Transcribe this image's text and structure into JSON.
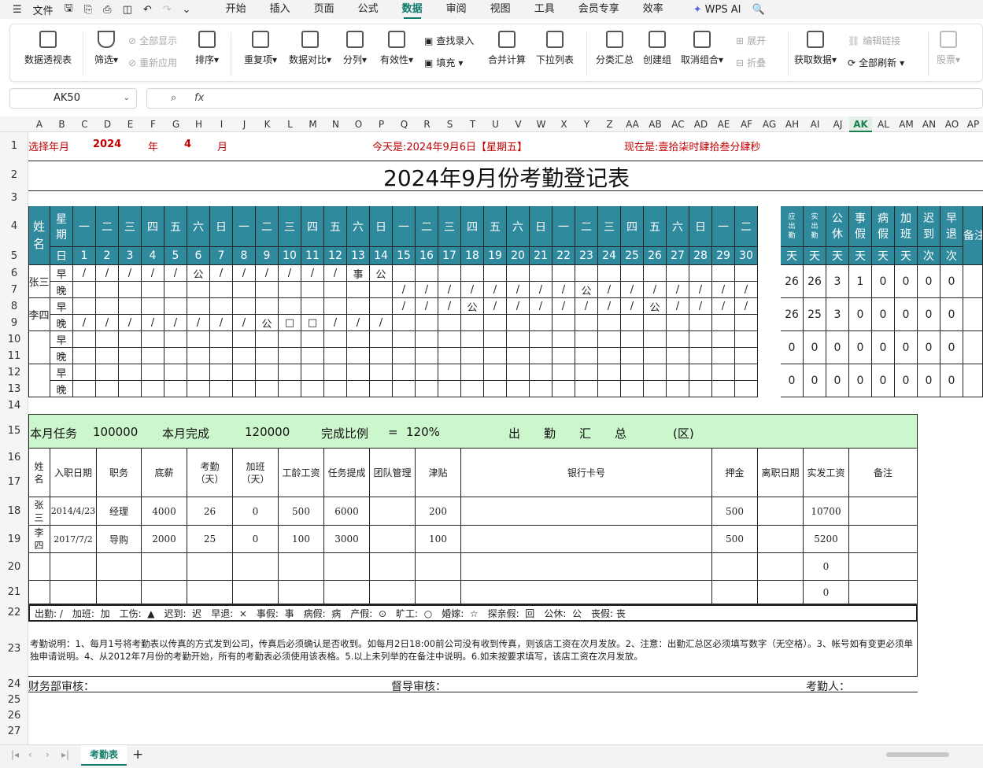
{
  "menubar": {
    "file": "文件",
    "tabs": [
      "开始",
      "插入",
      "页面",
      "公式",
      "数据",
      "审阅",
      "视图",
      "工具",
      "会员专享",
      "效率"
    ],
    "active_tab": "数据",
    "wps_ai": "WPS AI"
  },
  "ribbon": {
    "pivot": "数据透视表",
    "filter": "筛选",
    "show_all": "全部显示",
    "reapply": "重新应用",
    "sort": "排序",
    "duplicates": "重复项",
    "compare": "数据对比",
    "split": "分列",
    "validity": "有效性",
    "find_entry": "查找录入",
    "fill": "填充",
    "merge_calc": "合并计算",
    "dropdown_list": "下拉列表",
    "subtotal": "分类汇总",
    "create_group": "创建组",
    "ungroup": "取消组合",
    "expand": "展开",
    "collapse": "折叠",
    "get_data": "获取数据",
    "edit_links": "编辑链接",
    "refresh_all": "全部刷新",
    "stocks": "股票"
  },
  "formula_bar": {
    "cell_ref": "AK50",
    "fx": "fx",
    "value": ""
  },
  "columns": [
    "A",
    "B",
    "C",
    "D",
    "E",
    "F",
    "G",
    "H",
    "I",
    "J",
    "K",
    "L",
    "M",
    "N",
    "O",
    "P",
    "Q",
    "R",
    "S",
    "T",
    "U",
    "V",
    "W",
    "X",
    "Y",
    "Z",
    "AA",
    "AB",
    "AC",
    "AD",
    "AE",
    "AF",
    "AG",
    "AH",
    "AI",
    "AJ",
    "AK",
    "AL",
    "AM",
    "AN",
    "AO",
    "AP"
  ],
  "selected_column": "AK",
  "rows": [
    "1",
    "2",
    "3",
    "4",
    "5",
    "6",
    "7",
    "8",
    "9",
    "10",
    "11",
    "12",
    "13",
    "14",
    "15",
    "16",
    "17",
    "18",
    "19",
    "20",
    "21",
    "22",
    "23",
    "24",
    "25",
    "26",
    "27"
  ],
  "sheet": {
    "row1": {
      "select_label": "选择年月",
      "year": "2024",
      "year_unit": "年",
      "month": "4",
      "month_unit": "月",
      "today": "今天是:2024年9月6日【星期五】",
      "now": "现在是:壹拾柒时肆拾叁分肆秒"
    },
    "title": "2024年9月份考勤登记表",
    "header": {
      "name": "姓名",
      "week": "星期",
      "day": "日",
      "weekdays": [
        "一",
        "二",
        "三",
        "四",
        "五",
        "六",
        "日",
        "一",
        "二",
        "三",
        "四",
        "五",
        "六",
        "日",
        "一",
        "二",
        "三",
        "四",
        "五",
        "六",
        "日",
        "一",
        "二",
        "三",
        "四",
        "五",
        "六",
        "日",
        "一",
        "二"
      ],
      "days": [
        "1",
        "2",
        "3",
        "4",
        "5",
        "6",
        "7",
        "8",
        "9",
        "10",
        "11",
        "12",
        "13",
        "14",
        "15",
        "16",
        "17",
        "18",
        "19",
        "20",
        "21",
        "22",
        "23",
        "24",
        "25",
        "26",
        "27",
        "28",
        "29",
        "30"
      ],
      "summary": [
        "应出勤",
        "实出勤",
        "公休",
        "事假",
        "病假",
        "加班",
        "迟到",
        "早退"
      ],
      "summary_units": [
        "天",
        "天",
        "天",
        "天",
        "天",
        "天",
        "次",
        "次"
      ],
      "remark": "备注"
    },
    "employees": [
      {
        "name": "张三",
        "am_label": "早",
        "pm_label": "晚",
        "am": [
          "/",
          "/",
          "/",
          "/",
          "/",
          "公",
          "/",
          "/",
          "/",
          "/",
          "/",
          "/",
          "事",
          "公",
          "",
          "",
          "",
          "",
          "",
          "",
          "",
          "",
          "",
          "",
          "",
          "",
          "",
          "",
          "",
          ""
        ],
        "pm": [
          "",
          "",
          "",
          "",
          "",
          "",
          "",
          "",
          "",
          "",
          "",
          "",
          "",
          "",
          "/",
          "/",
          "/",
          "/",
          "/",
          "/",
          "/",
          "/",
          "公",
          "/",
          "/",
          "/",
          "/",
          "/",
          "/",
          "/"
        ],
        "stats": [
          "26",
          "26",
          "3",
          "1",
          "0",
          "0",
          "0",
          "0"
        ]
      },
      {
        "name": "李四",
        "am_label": "早",
        "pm_label": "晚",
        "am": [
          "",
          "",
          "",
          "",
          "",
          "",
          "",
          "",
          "",
          "",
          "",
          "",
          "",
          "",
          "/",
          "/",
          "/",
          "公",
          "/",
          "/",
          "/",
          "/",
          "/",
          "/",
          "/",
          "公",
          "/",
          "/",
          "/",
          "/"
        ],
        "pm": [
          "/",
          "/",
          "/",
          "/",
          "/",
          "/",
          "/",
          "/",
          "公",
          "□",
          "□",
          "/",
          "/",
          "/",
          "",
          "",
          "",
          "",
          "",
          "",
          "",
          "",
          "",
          "",
          "",
          "",
          "",
          "",
          "",
          ""
        ],
        "stats": [
          "26",
          "25",
          "3",
          "0",
          "0",
          "0",
          "0",
          "0"
        ]
      },
      {
        "name": "",
        "am_label": "早",
        "pm_label": "晚",
        "am": [],
        "pm": [],
        "stats": [
          "0",
          "0",
          "0",
          "0",
          "0",
          "0",
          "0",
          "0"
        ]
      },
      {
        "name": "",
        "am_label": "早",
        "pm_label": "晚",
        "am": [],
        "pm": [],
        "stats": [
          "0",
          "0",
          "0",
          "0",
          "0",
          "0",
          "0",
          "0"
        ]
      }
    ],
    "summary_bar": {
      "task_label": "本月任务",
      "task": "100000",
      "done_label": "本月完成",
      "done": "120000",
      "ratio_label": "完成比例",
      "eq": "=",
      "ratio": "120%",
      "title": "出　　勤　　汇　　总",
      "zone": "(区)"
    },
    "salary_headers": [
      "姓名",
      "入职日期",
      "职务",
      "底薪",
      "考勤（天）",
      "加班（天）",
      "工龄工资",
      "任务提成",
      "团队管理",
      "津贴",
      "银行卡号",
      "押金",
      "离职日期",
      "实发工资",
      "备注"
    ],
    "salary_rows": [
      [
        "张三",
        "2014/4/23",
        "经理",
        "4000",
        "26",
        "0",
        "500",
        "6000",
        "",
        "200",
        "",
        "500",
        "",
        "10700",
        ""
      ],
      [
        "李四",
        "2017/7/2",
        "导购",
        "2000",
        "25",
        "0",
        "100",
        "3000",
        "",
        "100",
        "",
        "500",
        "",
        "5200",
        ""
      ],
      [
        "",
        "",
        "",
        "",
        "",
        "",
        "",
        "",
        "",
        "",
        "",
        "",
        "",
        "0",
        ""
      ],
      [
        "",
        "",
        "",
        "",
        "",
        "",
        "",
        "",
        "",
        "",
        "",
        "",
        "",
        "0",
        ""
      ]
    ],
    "legend": [
      "出勤: /",
      "加班:  加",
      "工伤:  ▲",
      "迟到:  迟",
      "早退:  ×",
      "事假:  事",
      "病假:  病",
      "产假:  ⊙",
      "旷工:  ○",
      "婚嫁:  ☆",
      "探亲假:  回",
      "公休:  公",
      "丧假: 丧"
    ],
    "notes": "考勤说明：1、每月1号将考勤表以传真的方式发到公司，传真后必须确认是否收到。如每月2日18:00前公司没有收到传真，则该店工资在次月发放。2、注意：出勤汇总区必须填写数字（无空格）。3、帐号如有变更必须单独申请说明。4、从2012年7月份的考勤开始，所有的考勤表必须使用该表格。5.以上未列举的在备注中说明。6.如未按要求填写，该店工资在次月发放。",
    "sign": {
      "finance": "财务部审核：",
      "supervisor": "督导审核：",
      "clerk": "考勤人："
    }
  },
  "sheet_tab": "考勤表"
}
